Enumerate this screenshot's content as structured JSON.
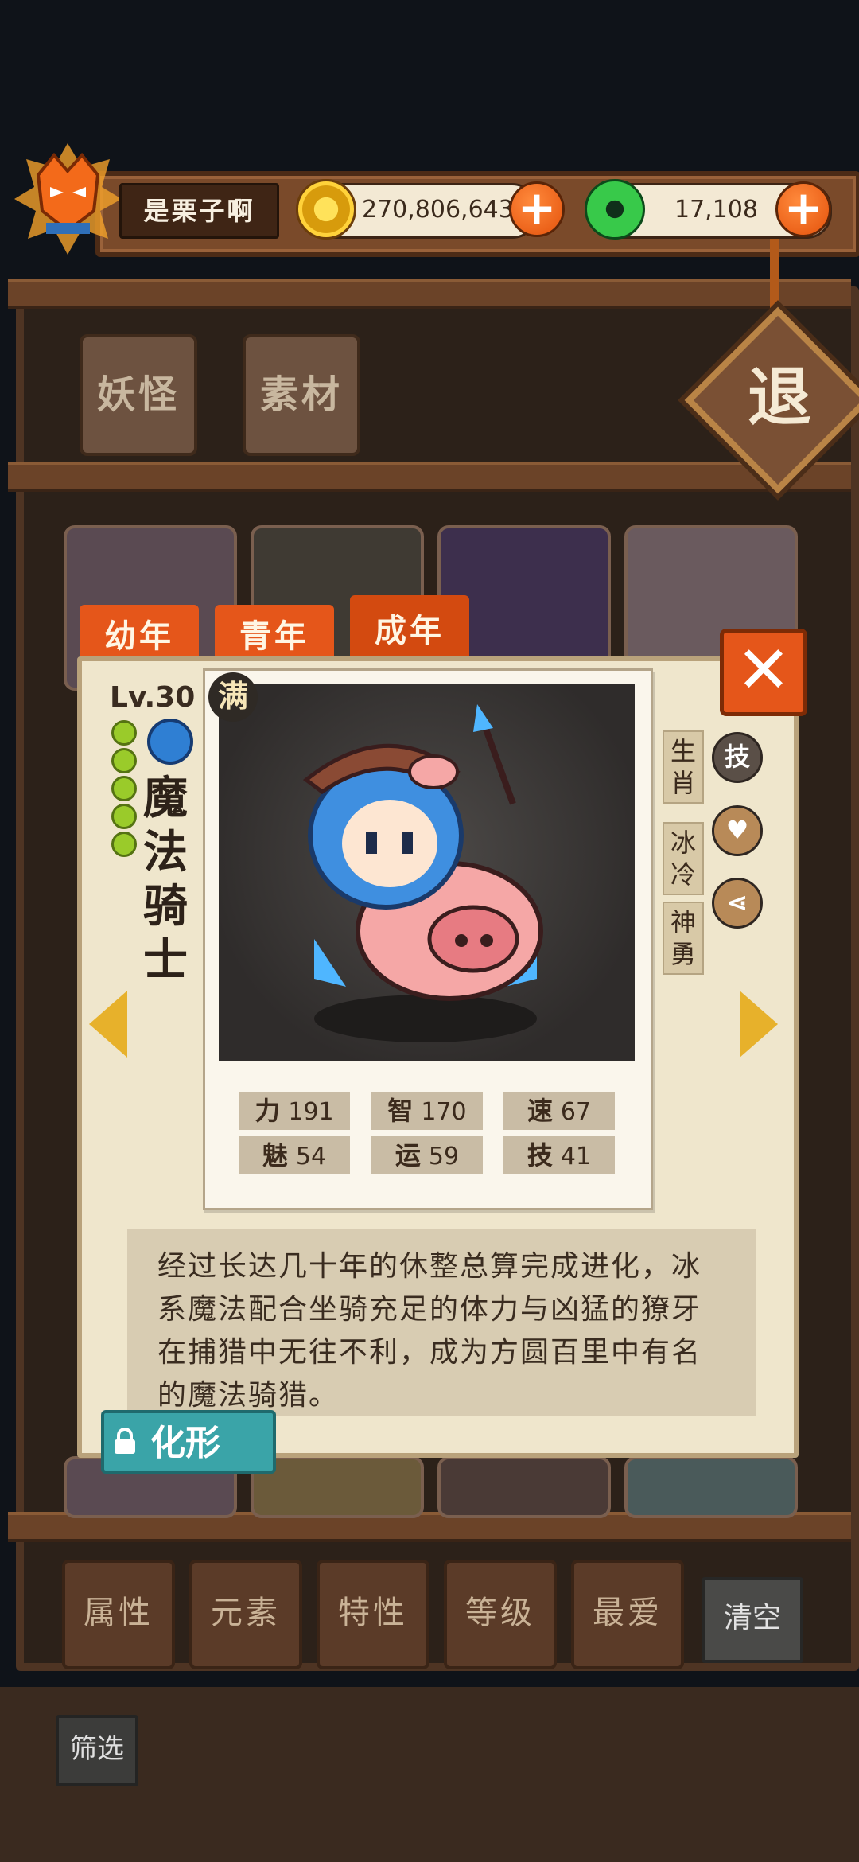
{
  "player": {
    "name": "是栗子啊"
  },
  "resources": {
    "gold": "270,806,643",
    "jade": "17,108",
    "plus_symbol": "+"
  },
  "top_tabs": [
    "妖怪",
    "素材"
  ],
  "exit_label": "退",
  "age_tabs": [
    "幼年",
    "青年",
    "成年"
  ],
  "active_age_tab": "成年",
  "close_symbol": "✕",
  "monster": {
    "level": "Lv.30",
    "max_badge": "满",
    "name": "魔法骑士",
    "stars": 5,
    "element": "water",
    "traits": [
      "生肖",
      "冰冷",
      "神勇"
    ],
    "action_icons": [
      "技",
      "heart-icon",
      "share-icon"
    ],
    "stats": [
      {
        "label": "力",
        "value": "191"
      },
      {
        "label": "智",
        "value": "170"
      },
      {
        "label": "速",
        "value": "67"
      },
      {
        "label": "魅",
        "value": "54"
      },
      {
        "label": "运",
        "value": "59"
      },
      {
        "label": "技",
        "value": "41"
      }
    ],
    "description": "经过长达几十年的休整总算完成进化，冰系魔法配合坐骑充足的体力与凶猛的獠牙在捕猎中无往不利，成为方圆百里中有名的魔法骑猎。",
    "evolve_button": "化形"
  },
  "filters": [
    "属性",
    "元素",
    "特性",
    "等级",
    "最爱"
  ],
  "clear_label": "清空",
  "screen_label": "筛选",
  "colors": {
    "accent": "#e5561a",
    "teal": "#3aa4a8",
    "wood": "#6b4328"
  }
}
